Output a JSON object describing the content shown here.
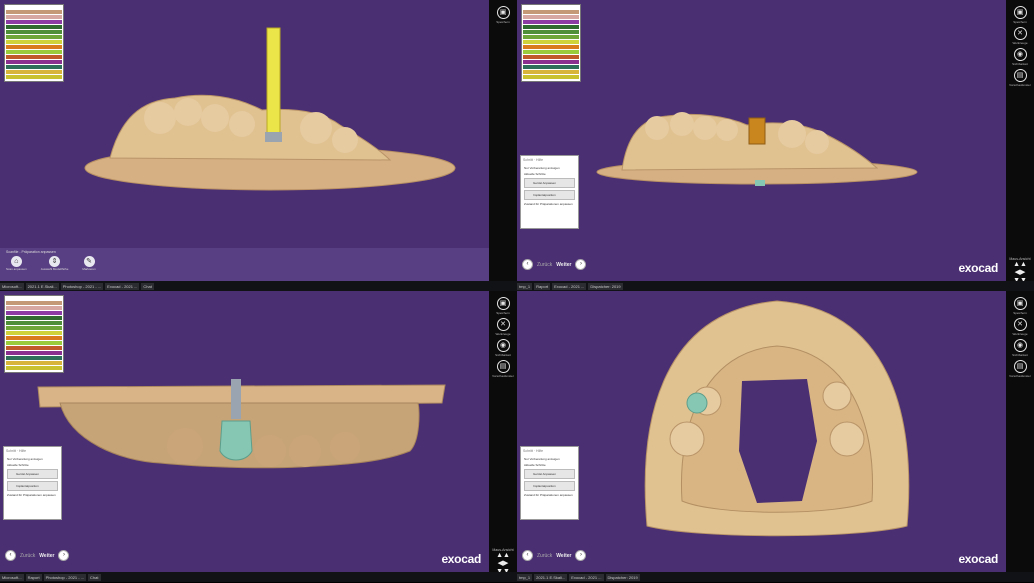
{
  "brand": {
    "logo": "exocad"
  },
  "toolbar": {
    "buttons": [
      "Speichern",
      "Werkzeuge",
      "Werkzeuge",
      "Sichtbarkeit",
      "Vorschaufenster"
    ],
    "nav_label": "Maus-Ansicht"
  },
  "wizard": {
    "back": "Zurück",
    "next": "Weiter",
    "tab1": "Schritt",
    "tab2": "Hilfe",
    "option": "Nur Vorbereitung anzeigen",
    "section": "Aktuelle Schritte",
    "item1": "Gerüst Anpassen",
    "item2": "Implantatposition",
    "footer": "Zustand für Präparationen anpassen"
  },
  "scan_panel": {
    "title": "Scanfile - Präparation anpassen",
    "tools": [
      "Scan anpassen",
      "Auswahl Modellhöhe",
      "Markieren"
    ]
  },
  "layer_colors": [
    "#c49a76",
    "#d6a7a0",
    "#8c3aa4",
    "#2f6b2f",
    "#4f8f3a",
    "#6fa63a",
    "#cfd23a",
    "#d97a1e",
    "#9acb3a",
    "#c05a2a",
    "#8a2f8f",
    "#2c6e5a",
    "#d9b43a",
    "#c9c22e"
  ],
  "taskbar": {
    "items": [
      "Microsoft...",
      "tmp_1",
      "2021.1 E.Skali...",
      "Raport",
      "Photoshop - 2021 - ...",
      "Exocad - 2021 ...",
      "Dispatcher: 2019",
      "Chat"
    ]
  },
  "colors": {
    "viewport": "#4a2f72",
    "model": "#e0c291",
    "implant": "#86c7b4"
  }
}
